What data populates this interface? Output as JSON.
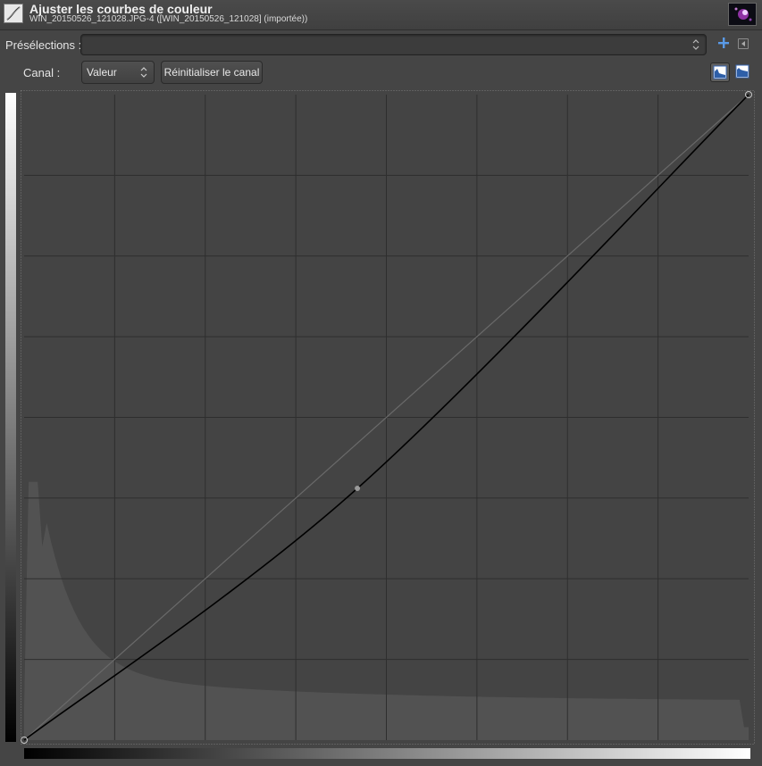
{
  "header": {
    "title": "Ajuster les courbes de couleur",
    "subtitle": "WIN_20150526_121028.JPG-4 ([WIN_20150526_121028] (importée))",
    "app_icon": "curves-tool-icon",
    "thumbnail": "image-thumbnail"
  },
  "presets": {
    "label": "Présélections :",
    "value": "",
    "add_icon": "plus-icon",
    "menu_icon": "panel-menu-icon"
  },
  "channel": {
    "label": "Canal :",
    "selected": "Valeur",
    "reset_label": "Réinitialiser le canal",
    "histogram_linear_icon": "linear-histogram-icon",
    "histogram_log_icon": "logarithmic-histogram-icon"
  },
  "curve": {
    "points": [
      [
        0,
        0
      ],
      [
        0.46,
        0.39
      ],
      [
        1,
        1
      ]
    ],
    "grid_divisions": 8,
    "colors": {
      "background": "#444444",
      "grid": "#2e2e2e",
      "histogram": "#525252",
      "identity_line": "#6a6a6a",
      "curve": "#000000",
      "control_point": "#9a9a9a"
    }
  }
}
